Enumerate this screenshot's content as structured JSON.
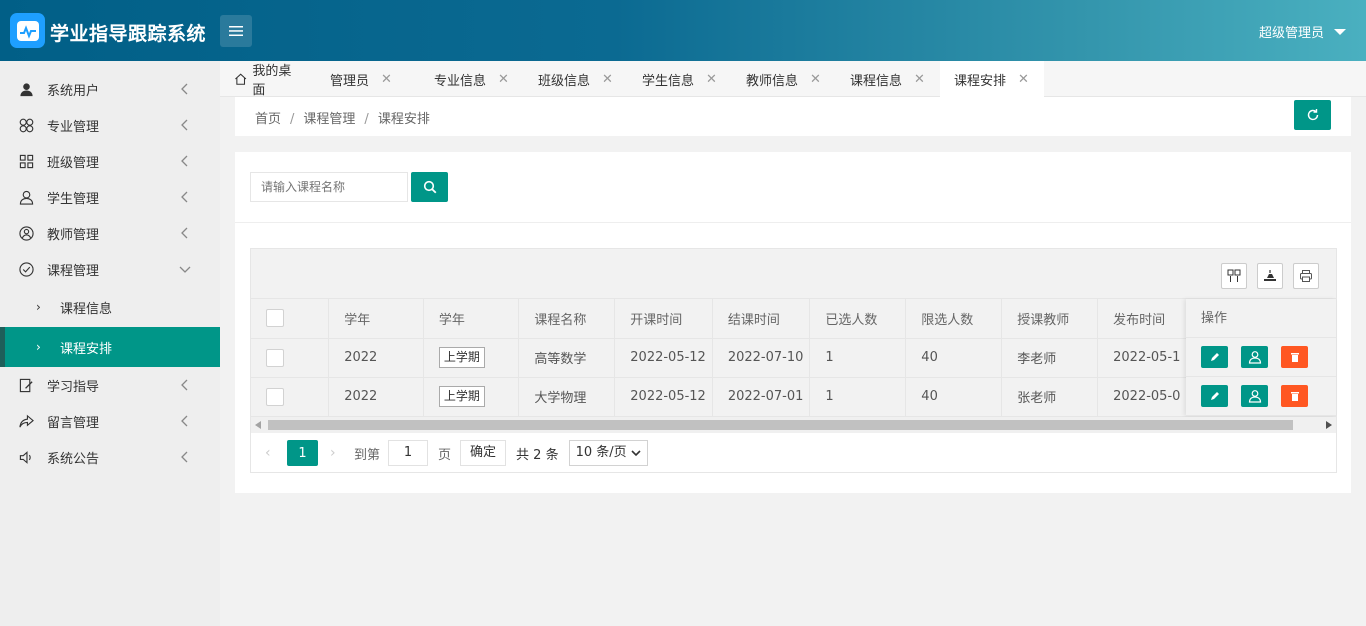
{
  "header": {
    "title": "学业指导跟踪系统",
    "user": "超级管理员"
  },
  "sidebar": {
    "items": [
      {
        "label": "系统用户",
        "icon": "user-icon"
      },
      {
        "label": "专业管理",
        "icon": "grid-flower-icon"
      },
      {
        "label": "班级管理",
        "icon": "apps-icon"
      },
      {
        "label": "学生管理",
        "icon": "users-icon"
      },
      {
        "label": "教师管理",
        "icon": "user-circle-icon"
      },
      {
        "label": "课程管理",
        "icon": "check-circle-icon",
        "expanded": true
      },
      {
        "label": "学习指导",
        "icon": "edit-icon"
      },
      {
        "label": "留言管理",
        "icon": "share-icon"
      },
      {
        "label": "系统公告",
        "icon": "speaker-icon"
      }
    ],
    "sub_items": [
      {
        "label": "课程信息"
      },
      {
        "label": "课程安排",
        "active": true
      }
    ]
  },
  "tabs": [
    "我的桌面",
    "管理员",
    "专业信息",
    "班级信息",
    "学生信息",
    "教师信息",
    "课程信息",
    "课程安排"
  ],
  "breadcrumb": [
    "首页",
    "课程管理",
    "课程安排"
  ],
  "breadcrumb_sep": "/",
  "search": {
    "placeholder": "请输入课程名称"
  },
  "table": {
    "columns": [
      "学年",
      "学年",
      "课程名称",
      "开课时间",
      "结课时间",
      "已选人数",
      "限选人数",
      "授课教师",
      "发布时间",
      "操作"
    ],
    "rows": [
      {
        "year": "2022",
        "term": "上学期",
        "course": "高等数学",
        "start": "2022-05-12",
        "end": "2022-07-10",
        "selected": "1",
        "limit": "40",
        "teacher": "李老师",
        "published": "2022-05-1"
      },
      {
        "year": "2022",
        "term": "上学期",
        "course": "大学物理",
        "start": "2022-05-12",
        "end": "2022-07-01",
        "selected": "1",
        "limit": "40",
        "teacher": "张老师",
        "published": "2022-05-0"
      }
    ]
  },
  "pagination": {
    "current": "1",
    "goto_label": "到第",
    "goto_value": "1",
    "page_unit": "页",
    "confirm": "确定",
    "total": "共 2 条",
    "page_size": "10 条/页"
  },
  "colors": {
    "accent": "#009688",
    "danger": "#ff5722",
    "header_start": "#015f87",
    "header_end": "#4ab0c0"
  }
}
